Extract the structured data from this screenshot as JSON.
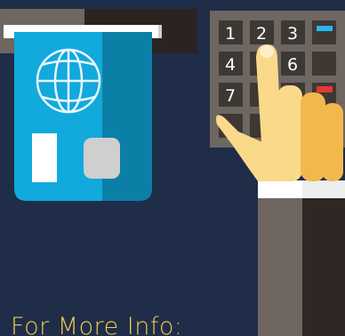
{
  "illustration": {
    "keypad_keys": [
      "1",
      "2",
      "3",
      "4",
      "6",
      "7"
    ],
    "caption": "For More Info:"
  },
  "colors": {
    "background": "#1f2d49",
    "card_light": "#12a9dd",
    "card_dark": "#0c7fa6",
    "keypad_frame": "#6e6660",
    "key_fill": "#3d3833",
    "key_accent_blue": "#29b6f6",
    "key_accent_red": "#e53935",
    "hand": "#fbd98a",
    "hand_shadow": "#f2b84b",
    "sleeve_light": "#6f6660",
    "sleeve_dark": "#2e2723",
    "cuff": "#ffffff",
    "caption": "#f2c94c"
  },
  "icons": [
    "atm-card-slot-icon",
    "bank-card-icon",
    "globe-icon",
    "keypad-icon",
    "hand-pressing-icon"
  ]
}
